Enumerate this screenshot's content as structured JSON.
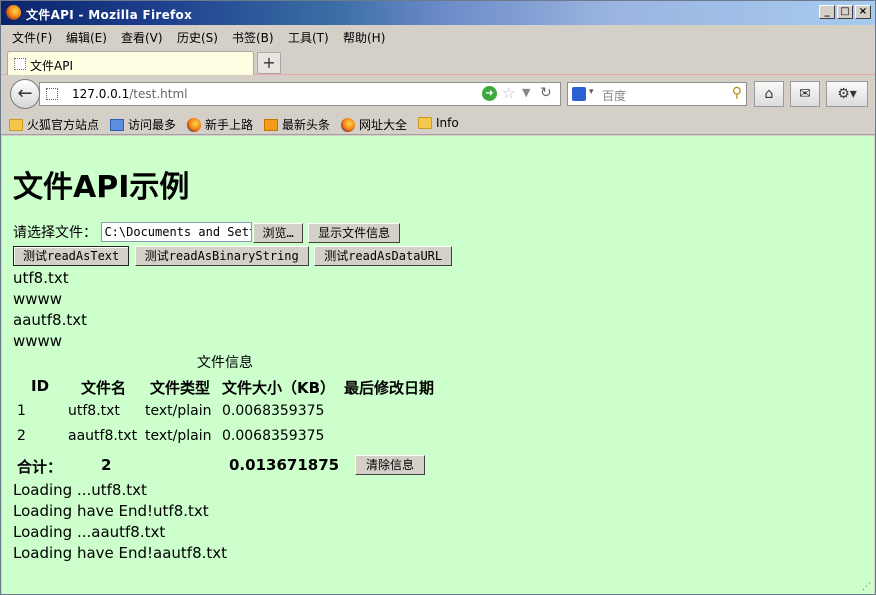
{
  "window": {
    "title": "文件API - Mozilla Firefox",
    "controls": [
      "_",
      "□",
      "×"
    ]
  },
  "menu": [
    "文件(F)",
    "编辑(E)",
    "查看(V)",
    "历史(S)",
    "书签(B)",
    "工具(T)",
    "帮助(H)"
  ],
  "tab": {
    "title": "文件API",
    "new_tab": "+"
  },
  "nav": {
    "url_host": "127.0.0.1",
    "url_path": "/test.html",
    "search_placeholder": "百度"
  },
  "bookmarks": [
    {
      "label": "火狐官方站点",
      "icon": "folder-icon"
    },
    {
      "label": "访问最多",
      "icon": "smart-folder-icon"
    },
    {
      "label": "新手上路",
      "icon": "firefox-icon"
    },
    {
      "label": "最新头条",
      "icon": "rss-icon"
    },
    {
      "label": "网址大全",
      "icon": "firefox-icon"
    },
    {
      "label": "Info",
      "icon": "folder-icon"
    }
  ],
  "page": {
    "heading": "文件API示例",
    "choose_label": "请选择文件：",
    "file_value": "C:\\Documents and Sett",
    "browse_label": "浏览…",
    "show_info_label": "显示文件信息",
    "btn_text": "测试readAsText",
    "btn_binary": "测试readAsBinaryString",
    "btn_dataurl": "测试readAsDataURL",
    "output_lines": [
      "utf8.txt",
      "wwww",
      "aautf8.txt",
      "wwww"
    ],
    "table": {
      "caption": "文件信息",
      "headers": [
        "ID",
        "文件名",
        "文件类型",
        "文件大小（KB）",
        "最后修改日期"
      ],
      "rows": [
        [
          "1",
          "utf8.txt",
          "text/plain",
          "0.0068359375",
          ""
        ],
        [
          "2",
          "aautf8.txt",
          "text/plain",
          "0.0068359375",
          ""
        ]
      ],
      "total_label": "合计：",
      "total_count": "2",
      "total_size": "0.013671875",
      "clear_label": "清除信息"
    },
    "log_lines": [
      "Loading ...utf8.txt",
      "Loading have End!utf8.txt",
      "Loading ...aautf8.txt",
      "Loading have End!aautf8.txt"
    ]
  },
  "colors": {
    "page_bg": "#ccffcc",
    "chrome_bg": "#d4d0c8",
    "title_start": "#0a246a"
  }
}
